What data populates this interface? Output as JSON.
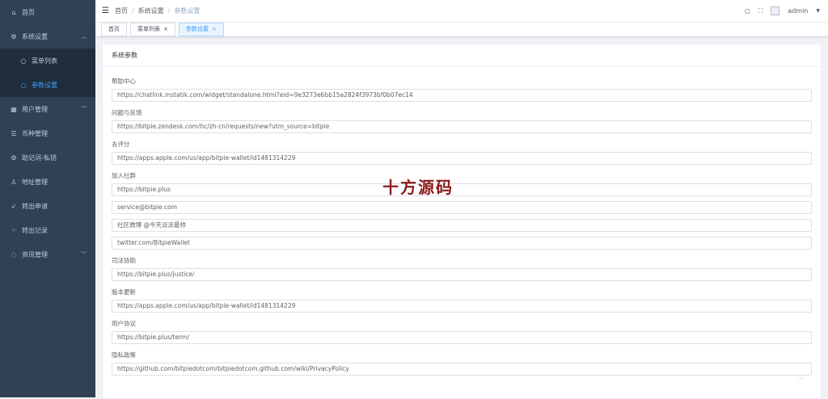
{
  "sidebar": {
    "items": [
      {
        "label": "首页",
        "icon": "home-icon"
      },
      {
        "label": "系统设置",
        "icon": "gear-icon",
        "expanded": true
      },
      {
        "label": "菜单列表",
        "icon": "circle-icon",
        "sub": true
      },
      {
        "label": "参数设置",
        "icon": "circle-icon",
        "sub": true,
        "active": true
      },
      {
        "label": "用户管理",
        "icon": "grid-icon",
        "has_arrow": true
      },
      {
        "label": "币种管理",
        "icon": "sliders-icon"
      },
      {
        "label": "助记词-私钥",
        "icon": "gear-icon"
      },
      {
        "label": "地址管理",
        "icon": "user-icon"
      },
      {
        "label": "转出申请",
        "icon": "rocket-icon"
      },
      {
        "label": "转出记录",
        "icon": "handshake-icon"
      },
      {
        "label": "资讯管理",
        "icon": "chat-icon",
        "has_arrow": true
      }
    ]
  },
  "breadcrumb": {
    "home": "首页",
    "level1": "系统设置",
    "level2": "参数设置",
    "sep": "/"
  },
  "header": {
    "username": "admin"
  },
  "tags": [
    {
      "label": "首页"
    },
    {
      "label": "菜单列表",
      "closable": true
    },
    {
      "label": "参数设置",
      "closable": true,
      "active": true
    }
  ],
  "card": {
    "title": "系统参数",
    "groups": [
      {
        "label": "帮助中心",
        "values": [
          "https://chatlink.mstatik.com/widget/standalone.html?eid=9e3273e6bb15a2824f3973bf0b07ec14"
        ]
      },
      {
        "label": "问题与反馈",
        "values": [
          "https://bitpie.zendesk.com/hc/zh-cn/requests/new?utm_source=bitpie"
        ]
      },
      {
        "label": "去评分",
        "values": [
          "https://apps.apple.com/us/app/bitpie-wallet/id1481314229"
        ]
      },
      {
        "label": "加入社群",
        "values": [
          "https://bitpie.plus",
          "service@bitpie.com",
          "社区微博 @今天派派最帅",
          "twitter.com/BitpieWallet"
        ]
      },
      {
        "label": "司法协助",
        "values": [
          "https://bitpie.plus/justice/"
        ]
      },
      {
        "label": "版本更新",
        "values": [
          "https://apps.apple.com/us/app/bitpie-wallet/id1481314229"
        ]
      },
      {
        "label": "用户协议",
        "values": [
          "https://bitpie.plus/term/"
        ]
      },
      {
        "label": "隐私政策",
        "values": [
          "https://github.com/bitpiedotcom/bitpiedotcom.github.com/wiki/PrivacyPolicy"
        ]
      }
    ]
  },
  "watermark": "十方源码",
  "colors": {
    "sidebar_bg": "#304156",
    "sidebar_text": "#bfcbd9",
    "active": "#409eff",
    "watermark": "#8b1a1a"
  }
}
